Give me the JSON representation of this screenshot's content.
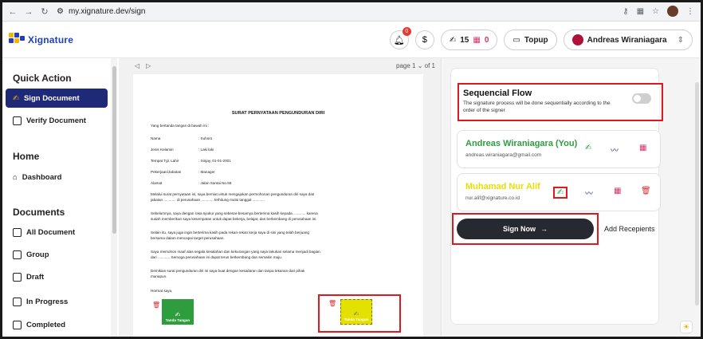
{
  "browser": {
    "url": "my.xignature.dev/sign",
    "icons": [
      "back-icon",
      "forward-icon",
      "reload-icon",
      "site-info-icon",
      "password-key-icon",
      "translate-icon",
      "star-icon",
      "profile-icon",
      "menu-icon"
    ]
  },
  "header": {
    "brand": "Xignature",
    "notification_count": "0",
    "sign_quota": "15",
    "stamp_quota": "0",
    "topup_label": "Topup",
    "user_name": "Andreas Wiraniagara"
  },
  "sidebar": {
    "section_quick": "Quick Action",
    "sign_document": "Sign Document",
    "verify_document": "Verify Document",
    "section_home": "Home",
    "dashboard": "Dashboard",
    "section_documents": "Documents",
    "all_document": "All Document",
    "group": "Group",
    "draft": "Draft",
    "in_progress": "In Progress",
    "completed": "Completed"
  },
  "viewer": {
    "page_label": "page",
    "page_current": "1",
    "page_of": "of 1"
  },
  "document": {
    "title": "SURAT PERNYATAAN PENGUNDURAN DIRI",
    "intro": "Yang bertanda tangan di bawah ini :",
    "fields": [
      {
        "k": "Nama",
        "v": ": Suhoro"
      },
      {
        "k": "Jenis Kelamin",
        "v": ": Laki laki"
      },
      {
        "k": "Tempat Tgl. Lahir",
        "v": ": Sinjay, 01-01-2001"
      },
      {
        "k": "Pekerjaan/Jabatan",
        "v": ": Manager"
      },
      {
        "k": "Alamat",
        "v": ": Jalan Santai No.58"
      }
    ],
    "p1a": "Melalui surat pernyataan ini, saya berniat untuk mengajukan permohonan pengunduran diri saya dari",
    "p1b": "jabatan ............ di perusahaan ............ terhitung mulai tanggal ............",
    "p2a": "Sebelumnya, saya dengan rasa syukur yang sebesar-besarnya berterima kasih kepada ............ karena",
    "p2b": "sudah memberikan saya kesempatan untuk dapat bekerja, belajar, dan berkembang di perusahaan ini.",
    "p3a": "Selain itu, saya juga ingin berterima kasih pada rekan-rekan kerja saya di sini yang telah berjuang",
    "p3b": "bersama dalam mencapai target perusahaan.",
    "p4a": "Saya memohon maaf atas segala kesalahan dan kekurangan yang saya lakukan selama menjadi bagian",
    "p4b": "dari ............ Semoga perusahaan ini dapat terus berkembang dan semakin maju.",
    "p5a": "Demikian surat pengunduran diri ini saya buat dengan kesadaran dan tanpa tekanan dari pihak",
    "p5b": "manapun.",
    "closing": "Hormat saya,",
    "sig_label_1": "Tanda Tangan",
    "sig_label_2": "Tanda Tangan"
  },
  "panel": {
    "flow_title": "Sequencial Flow",
    "flow_desc": "The signature process will be done sequentially according to the order of the signer",
    "flow_enabled": false,
    "signers": [
      {
        "name": "Andreas Wiraniagara (You)",
        "email": "andreas.wiraniagara@gmail.com"
      },
      {
        "name": "Muhamad Nur Alif",
        "email": "nur.alif@xignature.co.id"
      }
    ],
    "sign_now": "Sign Now",
    "add_recipients": "Add Recepients"
  },
  "colors": {
    "primary": "#1e2a78",
    "signer1": "#2e9d3e",
    "signer2": "#e4e000",
    "highlight": "#e0191e",
    "button_dark": "#26292f"
  }
}
